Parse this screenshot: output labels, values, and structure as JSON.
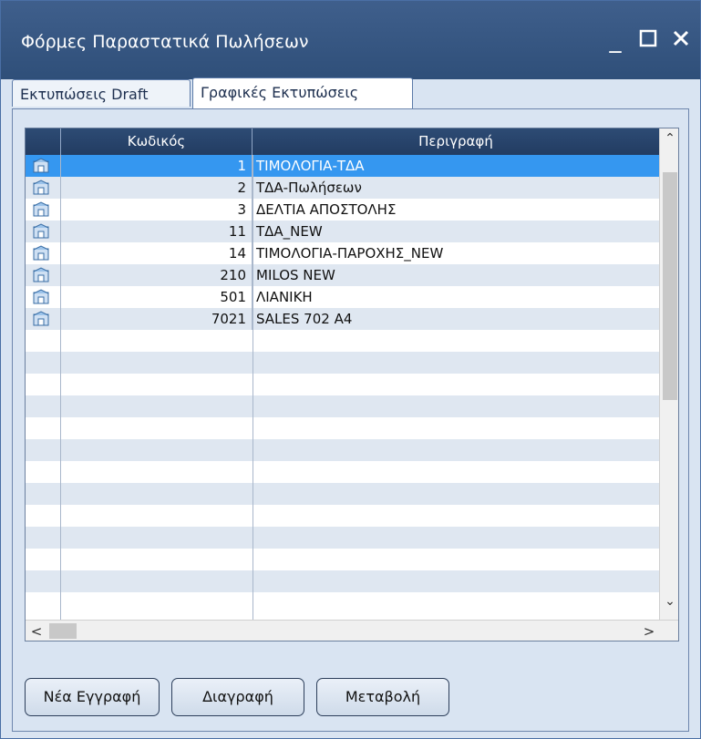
{
  "window": {
    "title": "Φόρμες Παραστατικά Πωλήσεων",
    "minimize_icon": "minimize-icon",
    "maximize_icon": "maximize-icon",
    "close_icon": "close-icon"
  },
  "tabs": [
    {
      "label": "Εκτυπώσεις Draft",
      "active": false
    },
    {
      "label": "Γραφικές Εκτυπώσεις",
      "active": true
    }
  ],
  "grid": {
    "columns": {
      "code": "Κωδικός",
      "description": "Περιγραφή"
    },
    "rows": [
      {
        "code": "1",
        "description": "ΤΙΜΟΛΟΓΙΑ-ΤΔΑ",
        "selected": true
      },
      {
        "code": "2",
        "description": "ΤΔΑ-Πωλήσεων"
      },
      {
        "code": "3",
        "description": "ΔΕΛΤΙΑ ΑΠΟΣΤΟΛΗΣ"
      },
      {
        "code": "11",
        "description": "ΤΔΑ_NEW"
      },
      {
        "code": "14",
        "description": "ΤΙΜΟΛΟΓΙΑ-ΠΑΡΟΧΗΣ_NEW"
      },
      {
        "code": "210",
        "description": "MILOS NEW"
      },
      {
        "code": "501",
        "description": "ΛΙΑΝΙΚΗ"
      },
      {
        "code": "7021",
        "description": "SALES 702 A4"
      }
    ]
  },
  "buttons": {
    "new_label": "Νέα Εγγραφή",
    "delete_label": "Διαγραφή",
    "edit_label": "Μεταβολή"
  },
  "colors": {
    "titlebar": "#2f4f79",
    "selected_row": "#3597f0",
    "alt_row": "#dfe7f1",
    "header": "#2d4b74"
  }
}
